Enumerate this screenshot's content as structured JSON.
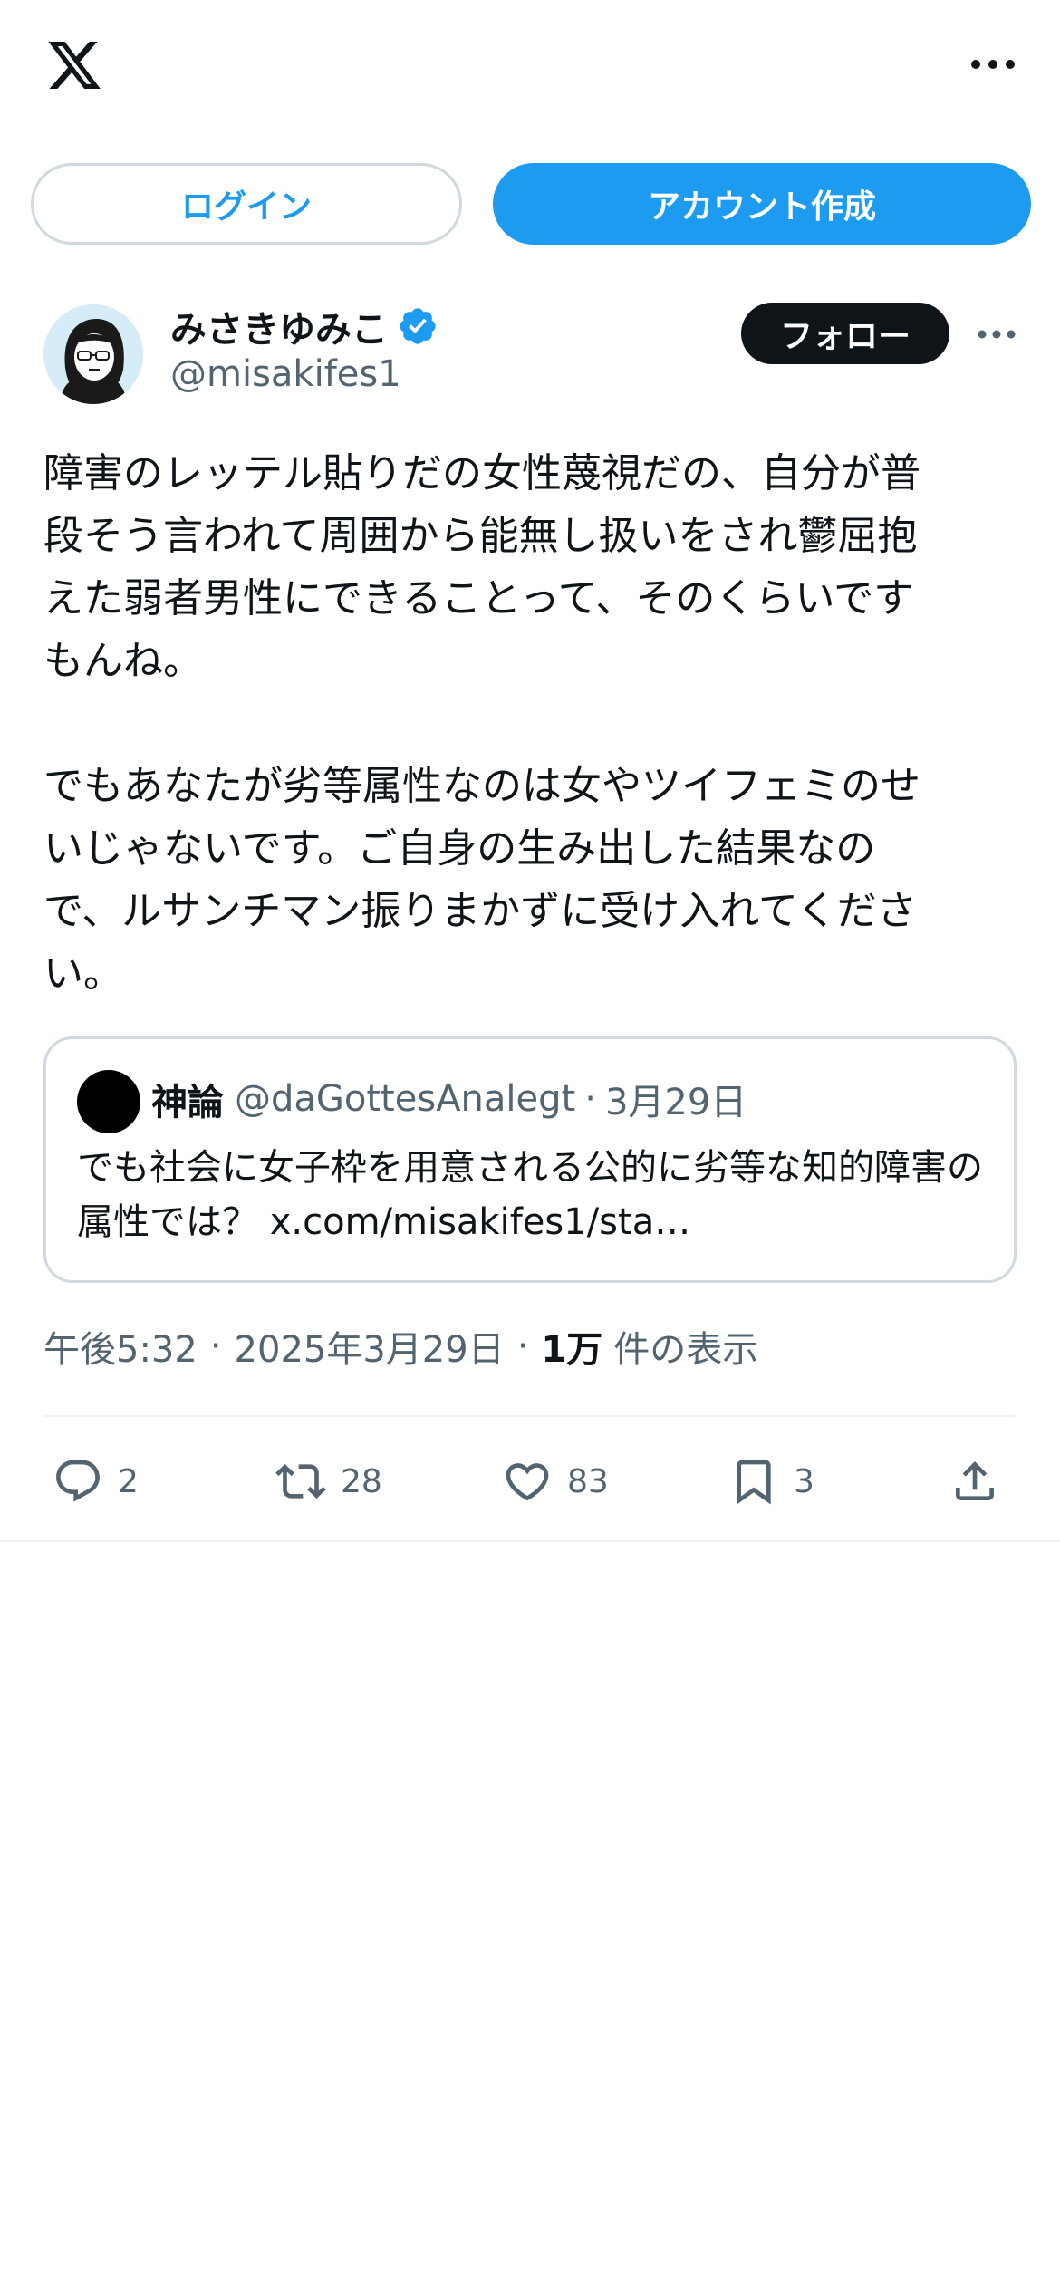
{
  "header": {
    "logo_icon": "x-logo-icon",
    "more_icon": "more-horizontal-icon"
  },
  "auth": {
    "login_label": "ログイン",
    "signup_label": "アカウント作成"
  },
  "post": {
    "author_name": "みさきゆみこ",
    "author_handle": "@misakifes1",
    "verified_icon": "verified-badge-icon",
    "follow_label": "フォロー",
    "text": "障害のレッテル貼りだの女性蔑視だの、自分が普\n段そう言われて周囲から能無し扱いをされ鬱屈抱\nえた弱者男性にできることって、そのくらいです\nもんね。\n\nでもあなたが劣等属性なのは女やツイフェミのせ\nいじゃないです。ご自身の生み出した結果なの\nで、ルサンチマン振りまかずに受け入れてくださ\nい。",
    "quote": {
      "author_name": "神論",
      "author_handle": "@daGottesAnalegt",
      "date": "3月29日",
      "text": "でも社会に女子枠を用意される公的に劣等な知的障害の属性では？ x.com/misakifes1/sta…"
    },
    "time": "午後5:32",
    "date": "2025年3月29日",
    "views_count": "1万",
    "views_label": "件の表示",
    "separator": "·",
    "actions": {
      "reply_count": "2",
      "retweet_count": "28",
      "like_count": "83",
      "bookmark_count": "3"
    }
  },
  "colors": {
    "accent": "#1d9bf0",
    "text_primary": "#0f1419",
    "text_secondary": "#536471",
    "border": "#cfd9de"
  }
}
